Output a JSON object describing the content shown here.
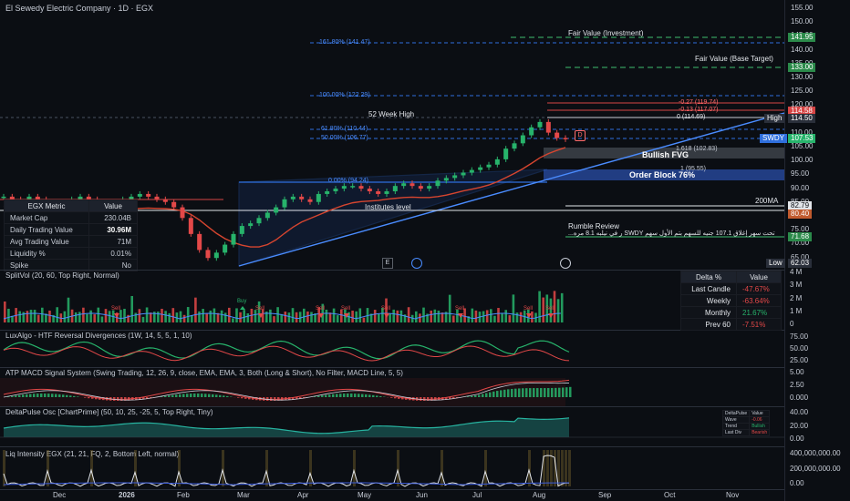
{
  "chart_title": "El Sewedy Electric Company · 1D · EGX",
  "main_axis": [
    "155.00",
    "150.00",
    "145.00",
    "140.00",
    "135.00",
    "130.00",
    "125.00",
    "120.00",
    "115.00",
    "110.00",
    "105.00",
    "100.00",
    "95.00",
    "90.00",
    "85.00",
    "80.00",
    "75.00",
    "70.00",
    "65.00"
  ],
  "price_tags": {
    "fair_inv": "141.95",
    "fair_base": "133.00",
    "fib_a": "114.58",
    "high": "114.50",
    "last": "107.53",
    "ma200": "82.79",
    "ma200_b": "80.40",
    "rumble": "71.68",
    "low": "62.03"
  },
  "tag_labels": {
    "high": "High",
    "ticker": "SWDY",
    "ma200": "200MA",
    "low": "Low"
  },
  "annotations": {
    "fair_value_investment": "Fair Value (Investment)",
    "fair_value_base": "Fair Value (Base Target)",
    "fib_161": "161.80% (141.47)",
    "fib_100": "100.00% (122.29)",
    "fib_neg27": "-0.27 (119.74)",
    "fib_neg13": "-0.13 (117.07)",
    "fib_0_high": "0 (114.69)",
    "week52": "52 Week High",
    "fib_61": "61.80% (110.44)",
    "fib_50": "50.00% (106.77)",
    "fib_1_618": "1.618 (102.83)",
    "bullish_fvg": "Bullish FVG",
    "fib_1_95": "1 (95.55)",
    "order_block": "Order Block 76%",
    "fib_0_lower": "0.00% (94.24)",
    "institutes": "Institutes level",
    "rumble_title": "Rumble Review",
    "rumble_text": "...ر في نيلبه 8.1 مره SWDY تحت سهر إغلاق 107.1 جنيه للسهم بتم الأول سهم",
    "d_marker": "D",
    "e_marker": "E"
  },
  "egx_table": {
    "header": [
      "EGX Metric",
      "Value"
    ],
    "rows": [
      [
        "Market Cap",
        "230.04B"
      ],
      [
        "Daily Trading Value",
        "30.96M"
      ],
      [
        "Avg Trading Value",
        "71M"
      ],
      [
        "Liquidity %",
        "0.01%"
      ],
      [
        "Spike",
        "No"
      ]
    ]
  },
  "delta_table": {
    "header": [
      "Delta %",
      "Value"
    ],
    "rows": [
      [
        "Last Candle",
        "-47.67%"
      ],
      [
        "Weekly",
        "-63.64%"
      ],
      [
        "Monthly",
        "21.67%"
      ],
      [
        "Prev 60",
        "-7.51%"
      ]
    ]
  },
  "panels": {
    "splitvol": "SplitVol (20, 60, Top Right, Normal)",
    "luxalgo": "LuxAlgo - HTF Reversal Divergences (1W, 14, 5, 5, 1, 10)",
    "macd": "ATP MACD Signal System (Swing Trading, 12, 26, 9, close, EMA, EMA, 3, Both (Long & Short), No Filter, MACD Line, 5, 5)",
    "deltapulse": "DeltaPulse Osc [ChartPrime] (50, 10, 25, -25, 5, Top Right, Tiny)",
    "liq": "Liq Intensity EGX (21, 21, FQ, 2, Bottom Left, normal)"
  },
  "vol_axis": [
    "4 M",
    "3 M",
    "2 M",
    "1 M",
    "0"
  ],
  "lux_axis": [
    "75.00",
    "50.00",
    "25.00"
  ],
  "macd_axis": [
    "5.00",
    "2.50",
    "0.000"
  ],
  "dp_axis": [
    "40.00",
    "20.00",
    "0.00"
  ],
  "liq_axis": [
    "400,000,000.00",
    "200,000,000.00",
    "0.00"
  ],
  "signals": {
    "buy": "Buy",
    "sell": "Sell"
  },
  "dp_mini": {
    "rows": [
      [
        "DeltaPulse",
        "Value"
      ],
      [
        "Wave",
        "-0.06"
      ],
      [
        "Trend",
        "Bullish"
      ],
      [
        "Last Div",
        "Bearish"
      ]
    ]
  },
  "time_axis": [
    "Dec",
    "2026",
    "Feb",
    "Mar",
    "Apr",
    "May",
    "Jun",
    "Jul",
    "Aug",
    "Sep",
    "Oct",
    "Nov"
  ],
  "chart_data": {
    "type": "line",
    "series": [
      {
        "values": [
          86,
          85,
          84,
          86,
          85,
          84,
          83,
          84,
          85,
          86,
          85,
          84,
          83,
          84,
          85,
          86,
          87,
          86,
          85,
          84,
          82,
          78,
          72,
          66,
          63,
          65,
          68,
          72,
          75,
          76,
          78,
          80,
          82,
          85,
          86,
          85,
          84,
          87,
          88,
          89,
          90,
          90,
          89,
          88,
          87,
          88,
          90,
          91,
          90,
          89,
          90,
          92,
          93,
          94,
          95,
          96,
          97,
          98,
          100,
          104,
          106,
          109,
          112,
          114,
          110,
          108,
          107.53
        ]
      }
    ],
    "ylim": [
      60,
      157
    ]
  }
}
